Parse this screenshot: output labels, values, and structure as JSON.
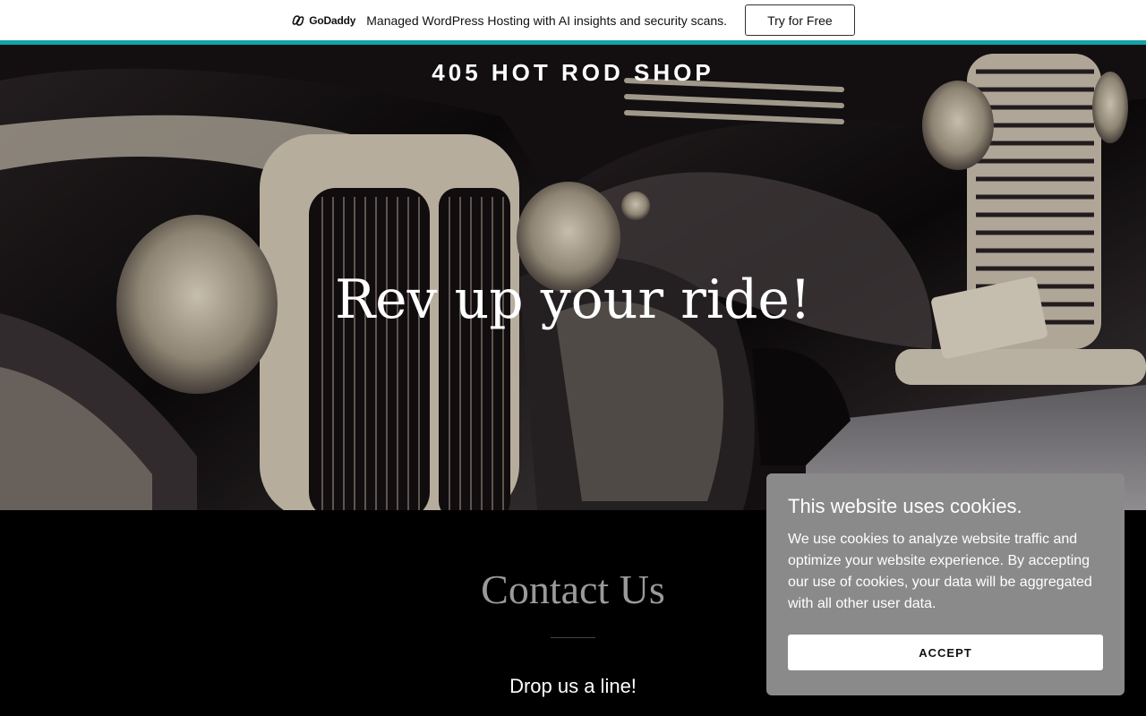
{
  "promo": {
    "brand": "GoDaddy",
    "text": "Managed WordPress Hosting with AI insights and security scans.",
    "cta": "Try for Free",
    "accent_color": "#13A2A6"
  },
  "hero": {
    "site_title": "405 HOT ROD SHOP",
    "tagline": "Rev up your ride!"
  },
  "contact": {
    "heading": "Contact Us",
    "subheading": "Drop us a line!"
  },
  "cookie_banner": {
    "title": "This website uses cookies.",
    "body": "We use cookies to analyze website traffic and optimize your website experience. By accepting our use of cookies, your data will be aggregated with all other user data.",
    "accept_label": "ACCEPT"
  }
}
